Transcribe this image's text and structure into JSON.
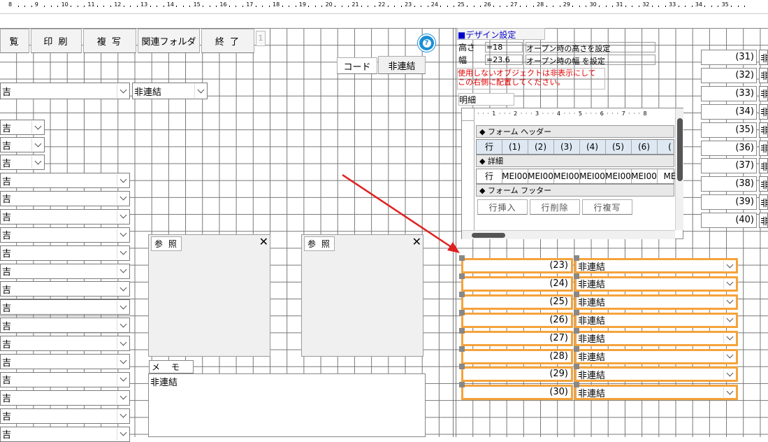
{
  "ruler": {
    "numbers": [
      "8",
      "9",
      "10",
      "11",
      "12",
      "13",
      "14",
      "15",
      "16",
      "17",
      "18",
      "19",
      "20",
      "21",
      "22",
      "23",
      "24",
      "25",
      "26",
      "27",
      "28",
      "29",
      "30",
      "31",
      "32",
      "33",
      "34",
      "35"
    ]
  },
  "toolbar": {
    "view_label": "覧",
    "print_label": "印 刷",
    "copy_label": "複 写",
    "related_folder_label": "関連フォルダ",
    "close_label": "終 了",
    "page_indicator": "1"
  },
  "tabs": {
    "code_label": "コード",
    "unlinked_label": "非連結"
  },
  "left": {
    "wide_combo_value": "吉",
    "mid_combo_value": "非連結",
    "small_combo_values": [
      "吉",
      "吉",
      "吉"
    ],
    "long_combo_values": [
      "吉",
      "吉",
      "吉",
      "吉",
      "吉",
      "吉",
      "吉",
      "吉",
      "吉",
      "吉",
      "吉",
      "吉",
      "吉",
      "吉",
      "吉"
    ]
  },
  "ref_panels": [
    {
      "label": "参 照",
      "close": "✕"
    },
    {
      "label": "参 照",
      "close": "✕"
    }
  ],
  "memo": {
    "label": "メ モ",
    "value": "非連結"
  },
  "design": {
    "title": "■デザイン設定",
    "height_label": "高さ",
    "height_value": "=18",
    "height_desc": "オープン時の高さを設定",
    "width_label": "幅",
    "width_value": "=23.6",
    "width_desc": "オープン時の幅 を設定",
    "warning_line1": "使用しないオブジェクトは非表示にして",
    "warning_line2": "この右側に配置してください。",
    "detail_label": "明細"
  },
  "subform": {
    "ruler_text": "· · · 1 · · · 2 · · · 3 · · · 4 · · · 5 · · · 6 · · · 7 · · · 8",
    "form_header": "フォーム ヘッダー",
    "header_cells": [
      "行",
      "(1)",
      "(2)",
      "(3)",
      "(4)",
      "(5)",
      "(6)",
      "("
    ],
    "detail_section": "詳細",
    "detail_cells": [
      "行",
      "MEI00",
      "MEI00",
      "MEI00",
      "MEI00",
      "MEI00",
      "MEI00",
      "ME"
    ],
    "form_footer": "フォーム フッター",
    "footer_buttons": [
      "行挿入",
      "行削除",
      "行複写"
    ]
  },
  "selected_rows": [
    {
      "label": "(23)",
      "value": "非連結"
    },
    {
      "label": "(24)",
      "value": "非連結"
    },
    {
      "label": "(25)",
      "value": "非連結"
    },
    {
      "label": "(26)",
      "value": "非連結"
    },
    {
      "label": "(27)",
      "value": "非連結"
    },
    {
      "label": "(28)",
      "value": "非連結"
    },
    {
      "label": "(29)",
      "value": "非連結"
    },
    {
      "label": "(30)",
      "value": "非連結"
    }
  ],
  "right_rows": [
    {
      "label": "(31)",
      "value": "非"
    },
    {
      "label": "(32)",
      "value": "非"
    },
    {
      "label": "(33)",
      "value": "非"
    },
    {
      "label": "(34)",
      "value": "非"
    },
    {
      "label": "(35)",
      "value": "非"
    },
    {
      "label": "(36)",
      "value": "非"
    },
    {
      "label": "(37)",
      "value": "非"
    },
    {
      "label": "(38)",
      "value": "非"
    },
    {
      "label": "(39)",
      "value": "非"
    },
    {
      "label": "(40)",
      "value": "非"
    }
  ],
  "icons": {
    "help": "question-circle-icon"
  },
  "colors": {
    "selection": "#f5a33c",
    "help_blue": "#1a8fd6",
    "warning_red": "#e00000",
    "arrow_red": "#e02020"
  }
}
